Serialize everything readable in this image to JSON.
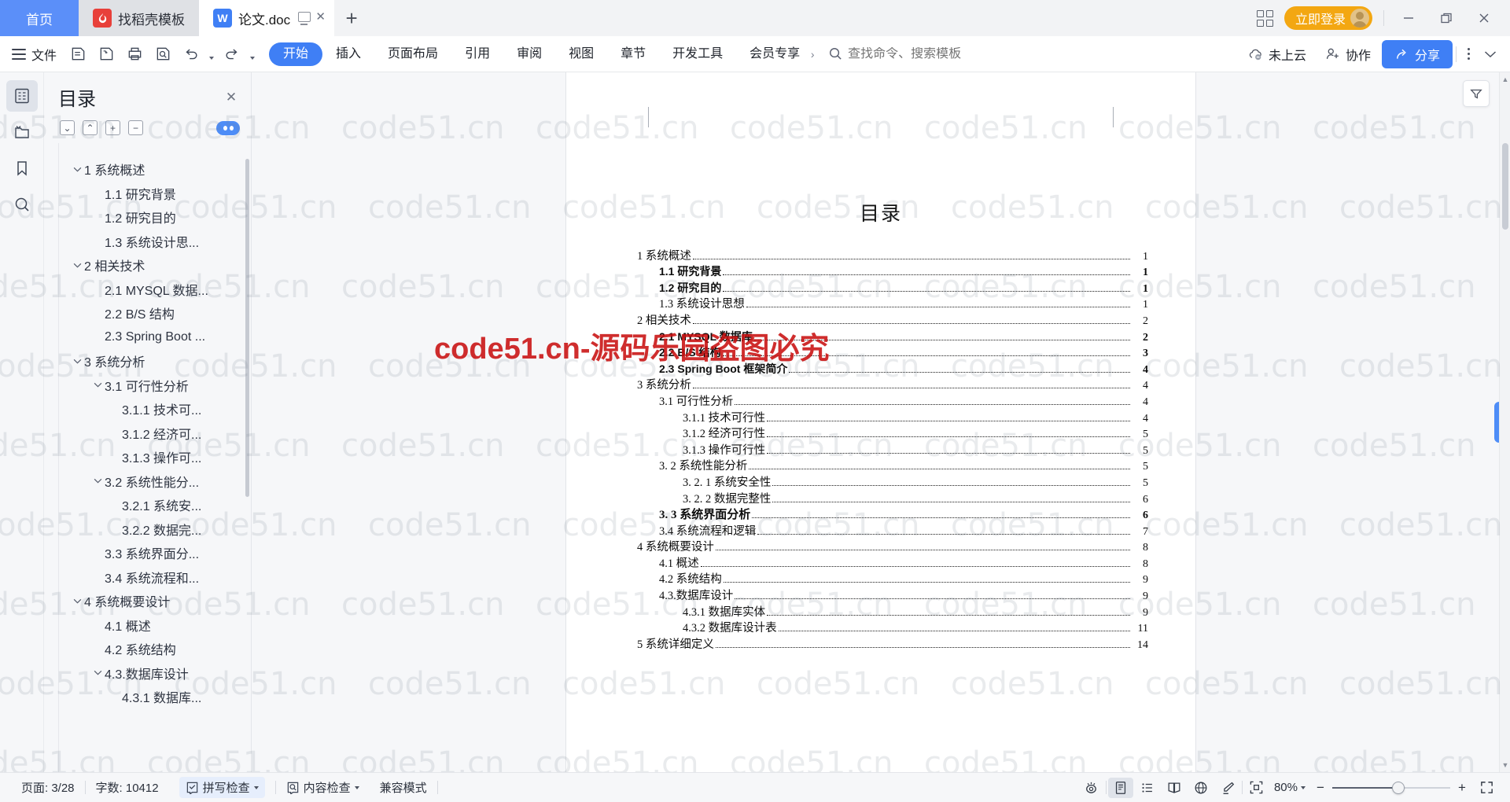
{
  "window": {
    "tabs": [
      {
        "label": "首页",
        "type": "home"
      },
      {
        "label": "找稻壳模板",
        "type": "template",
        "icon": "flame-icon"
      },
      {
        "label": "论文.doc",
        "type": "doc",
        "icon": "w-doc-icon",
        "active": true
      }
    ],
    "new_tab_label": "+",
    "apps_grid_name": "apps-grid-icon",
    "login_label": "立即登录",
    "minimize_label": "—",
    "restore_label": "❐",
    "close_label": "✕"
  },
  "ribbon": {
    "menu_icon": "hamburger-icon",
    "file_label": "文件",
    "quick_tools": [
      "new-file-icon",
      "save-cloud-icon",
      "print-icon",
      "print-preview-icon",
      "undo-icon",
      "redo-icon"
    ],
    "tabs": [
      {
        "label": "开始",
        "active": true
      },
      {
        "label": "插入",
        "active": false
      },
      {
        "label": "页面布局",
        "active": false
      },
      {
        "label": "引用",
        "active": false
      },
      {
        "label": "审阅",
        "active": false
      },
      {
        "label": "视图",
        "active": false
      },
      {
        "label": "章节",
        "active": false
      },
      {
        "label": "开发工具",
        "active": false
      },
      {
        "label": "会员专享",
        "active": false
      }
    ],
    "search": {
      "placeholder": "查找命令、搜索模板",
      "value": "",
      "icon": "search-icon"
    },
    "cloud_status_label": "未上云",
    "collab_label": "协作",
    "share_label": "分享",
    "more_label": "more-options-icon",
    "accent_blue": "#3f7ff5",
    "accent_orange": "#f3a712"
  },
  "rail": {
    "items": [
      {
        "name": "outline-panel-icon",
        "active": true
      },
      {
        "name": "folder-panel-icon",
        "active": false
      },
      {
        "name": "bookmark-panel-icon",
        "active": false
      },
      {
        "name": "search-panel-icon",
        "active": false
      }
    ]
  },
  "toc_panel": {
    "title": "目录",
    "close_label": "✕",
    "tools": [
      {
        "name": "collapse-down-button",
        "glyph": "⌄"
      },
      {
        "name": "collapse-up-button",
        "glyph": "⌃"
      },
      {
        "name": "expand-all-button",
        "glyph": "+"
      },
      {
        "name": "collapse-all-button",
        "glyph": "−"
      }
    ],
    "eye_toggle_name": "visibility-toggle",
    "items": [
      {
        "label": "1 系统概述",
        "level": 1,
        "chevron": "⌄"
      },
      {
        "label": "1.1  研究背景",
        "level": 2,
        "chevron": ""
      },
      {
        "label": "1.2 研究目的",
        "level": 2,
        "chevron": ""
      },
      {
        "label": "1.3 系统设计思...",
        "level": 2,
        "chevron": ""
      },
      {
        "label": "2 相关技术",
        "level": 1,
        "chevron": "⌄"
      },
      {
        "label": "2.1 MYSQL 数据...",
        "level": 2,
        "chevron": ""
      },
      {
        "label": "2.2 B/S 结构",
        "level": 2,
        "chevron": ""
      },
      {
        "label": "2.3 Spring Boot ...",
        "level": 2,
        "chevron": ""
      },
      {
        "label": "3 系统分析",
        "level": 1,
        "chevron": "⌄"
      },
      {
        "label": "3.1 可行性分析",
        "level": 2,
        "chevron": "⌄"
      },
      {
        "label": "3.1.1 技术可...",
        "level": 3,
        "chevron": ""
      },
      {
        "label": "3.1.2 经济可...",
        "level": 3,
        "chevron": ""
      },
      {
        "label": "3.1.3 操作可...",
        "level": 3,
        "chevron": ""
      },
      {
        "label": "3.2 系统性能分...",
        "level": 2,
        "chevron": "⌄"
      },
      {
        "label": "3.2.1  系统安...",
        "level": 3,
        "chevron": ""
      },
      {
        "label": "3.2.2  数据完...",
        "level": 3,
        "chevron": ""
      },
      {
        "label": "3.3 系统界面分...",
        "level": 2,
        "chevron": ""
      },
      {
        "label": "3.4 系统流程和...",
        "level": 2,
        "chevron": ""
      },
      {
        "label": "4 系统概要设计",
        "level": 1,
        "chevron": "⌄"
      },
      {
        "label": "4.1 概述",
        "level": 2,
        "chevron": ""
      },
      {
        "label": "4.2 系统结构",
        "level": 2,
        "chevron": ""
      },
      {
        "label": "4.3.数据库设计",
        "level": 2,
        "chevron": "⌄"
      },
      {
        "label": "4.3.1 数据库...",
        "level": 3,
        "chevron": ""
      }
    ]
  },
  "document": {
    "heading": "目录",
    "entries": [
      {
        "text": "1 系统概述",
        "page": "1",
        "style": "lv1"
      },
      {
        "text": "1.1  研究背景",
        "page": "1",
        "style": "lv2"
      },
      {
        "text": "1.2 研究目的",
        "page": "1",
        "style": "lv2"
      },
      {
        "text": "1.3 系统设计思想",
        "page": "1",
        "style": "lv2s"
      },
      {
        "text": "2 相关技术",
        "page": "2",
        "style": "lv1"
      },
      {
        "text": "2.1 MYSQL 数据库",
        "page": "2",
        "style": "lv2"
      },
      {
        "text": "2.2 B/S 结构",
        "page": "3",
        "style": "lv2"
      },
      {
        "text": "2.3 Spring Boot 框架简介",
        "page": "4",
        "style": "lv2"
      },
      {
        "text": "3 系统分析",
        "page": "4",
        "style": "lv1"
      },
      {
        "text": "3.1 可行性分析",
        "page": "4",
        "style": "lv2s"
      },
      {
        "text": "3.1.1 技术可行性",
        "page": "4",
        "style": "lv3"
      },
      {
        "text": "3.1.2 经济可行性",
        "page": "5",
        "style": "lv3"
      },
      {
        "text": "3.1.3 操作可行性",
        "page": "5",
        "style": "lv3"
      },
      {
        "text": "3. 2 系统性能分析",
        "page": "5",
        "style": "lv2s"
      },
      {
        "text": "3. 2. 1  系统安全性",
        "page": "5",
        "style": "lv3"
      },
      {
        "text": "3. 2. 2  数据完整性",
        "page": "6",
        "style": "lv3"
      },
      {
        "text": "3. 3 系统界面分析",
        "page": "6",
        "style": "lv3b"
      },
      {
        "text": "3.4 系统流程和逻辑",
        "page": "7",
        "style": "lv2s"
      },
      {
        "text": "4 系统概要设计",
        "page": "8",
        "style": "lv1"
      },
      {
        "text": "4.1 概述",
        "page": "8",
        "style": "lv2s"
      },
      {
        "text": "4.2 系统结构",
        "page": "9",
        "style": "lv2s"
      },
      {
        "text": "4.3.数据库设计",
        "page": "9",
        "style": "lv2s"
      },
      {
        "text": "4.3.1 数据库实体",
        "page": "9",
        "style": "lv3"
      },
      {
        "text": "4.3.2 数据库设计表",
        "page": "11",
        "style": "lv3"
      },
      {
        "text": "5 系统详细定义",
        "page": "14",
        "style": "lv1"
      }
    ]
  },
  "watermark": {
    "tile_text": "code51.cn",
    "red_text": "code51.cn-源码乐园盗图必究"
  },
  "status": {
    "page_label": "页面: 3/28",
    "word_count_label": "字数: 10412",
    "spellcheck_label": "拼写检查",
    "content_check_label": "内容检查",
    "compat_label": "兼容模式",
    "view_icons": [
      {
        "name": "eye-care-icon",
        "active": false
      },
      {
        "name": "page-view-icon",
        "active": true
      },
      {
        "name": "outline-view-icon",
        "active": false
      },
      {
        "name": "reading-view-icon",
        "active": false
      },
      {
        "name": "web-view-icon",
        "active": false
      },
      {
        "name": "marker-pen-icon",
        "active": false
      }
    ],
    "fit_page_icon": "fit-page-icon",
    "zoom_label": "80%",
    "zoom_out_label": "−",
    "zoom_in_label": "+",
    "fullscreen_icon": "fullscreen-icon"
  }
}
